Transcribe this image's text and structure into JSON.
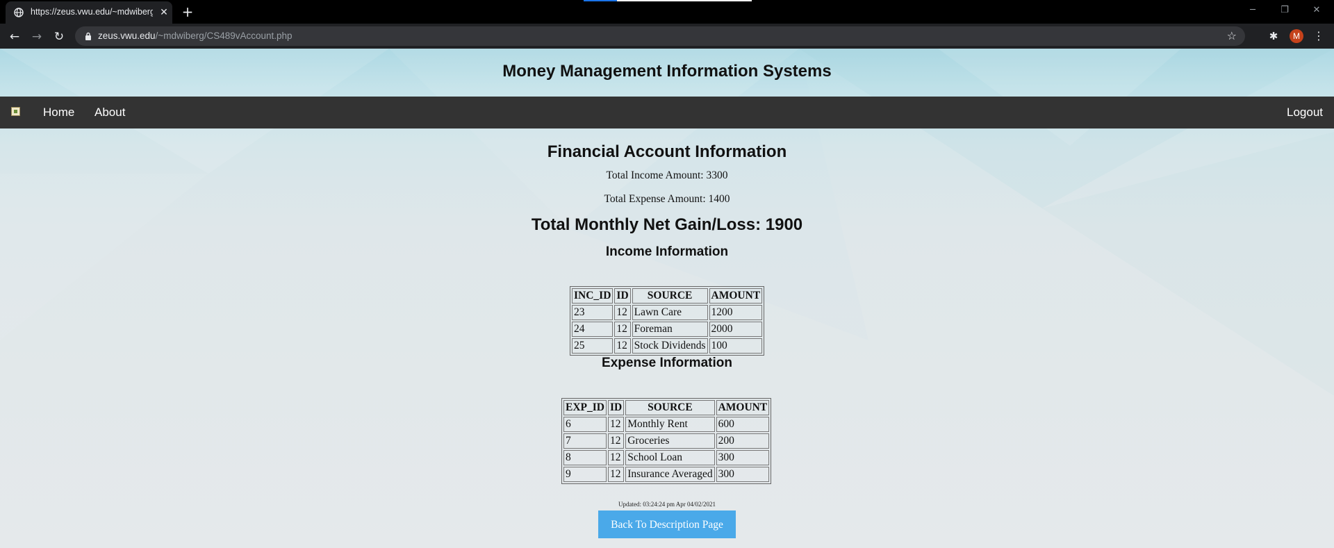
{
  "browser": {
    "tab_title": "https://zeus.vwu.edu/~mdwiberg/CS489vAccount.php",
    "url_host": "zeus.vwu.edu",
    "url_path": "/~mdwiberg/CS489vAccount.php",
    "avatar_letter": "M"
  },
  "site": {
    "title": "Money Management Information Systems",
    "nav": {
      "home": "Home",
      "about": "About",
      "logout": "Logout"
    }
  },
  "account": {
    "heading": "Financial Account Information",
    "total_income": "Total Income Amount: 3300",
    "total_expense": "Total Expense Amount: 1400",
    "net": "Total Monthly Net Gain/Loss: 1900"
  },
  "income": {
    "heading": "Income Information",
    "columns": [
      "INC_ID",
      "ID",
      "SOURCE",
      "AMOUNT"
    ],
    "rows": [
      [
        "23",
        "12",
        "Lawn Care",
        "1200"
      ],
      [
        "24",
        "12",
        "Foreman",
        "2000"
      ],
      [
        "25",
        "12",
        "Stock Dividends",
        "100"
      ]
    ]
  },
  "expense": {
    "heading": "Expense Information",
    "columns": [
      "EXP_ID",
      "ID",
      "SOURCE",
      "AMOUNT"
    ],
    "rows": [
      [
        "6",
        "12",
        "Monthly Rent",
        "600"
      ],
      [
        "7",
        "12",
        "Groceries",
        "200"
      ],
      [
        "8",
        "12",
        "School Loan",
        "300"
      ],
      [
        "9",
        "12",
        "Insurance Averaged",
        "300"
      ]
    ]
  },
  "footer": {
    "updated": "Updated: 03:24:24 pm Apr 04/02/2021",
    "back_button": "Back To Description Page"
  }
}
